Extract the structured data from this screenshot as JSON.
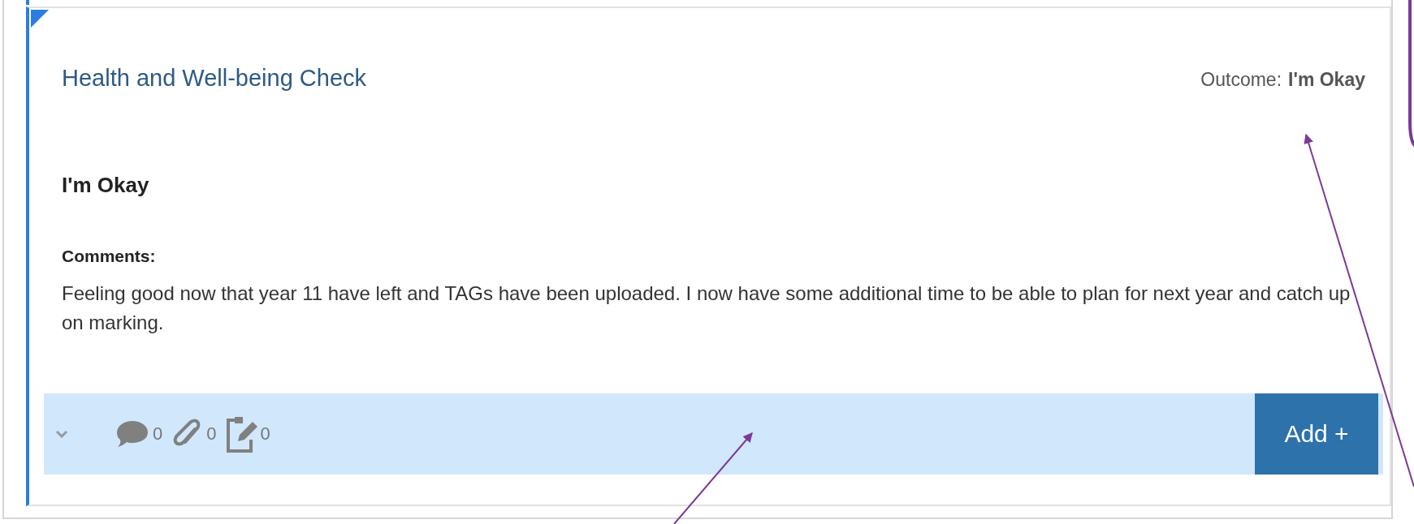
{
  "card": {
    "title": "Health and Well-being Check",
    "outcome_label": "Outcome:",
    "outcome_value": "I'm Okay",
    "response": "I'm Okay",
    "comments_label": "Comments:",
    "comments": "Feeling good now that year 11 have left and TAGs have been uploaded. I now have some additional time to be able to plan for next year and catch up on marking."
  },
  "footer": {
    "expanded": false,
    "counters": [
      {
        "kind": "comment",
        "count": "0"
      },
      {
        "kind": "attachment",
        "count": "0"
      },
      {
        "kind": "note",
        "count": "0"
      }
    ],
    "add_button": "Add +"
  }
}
